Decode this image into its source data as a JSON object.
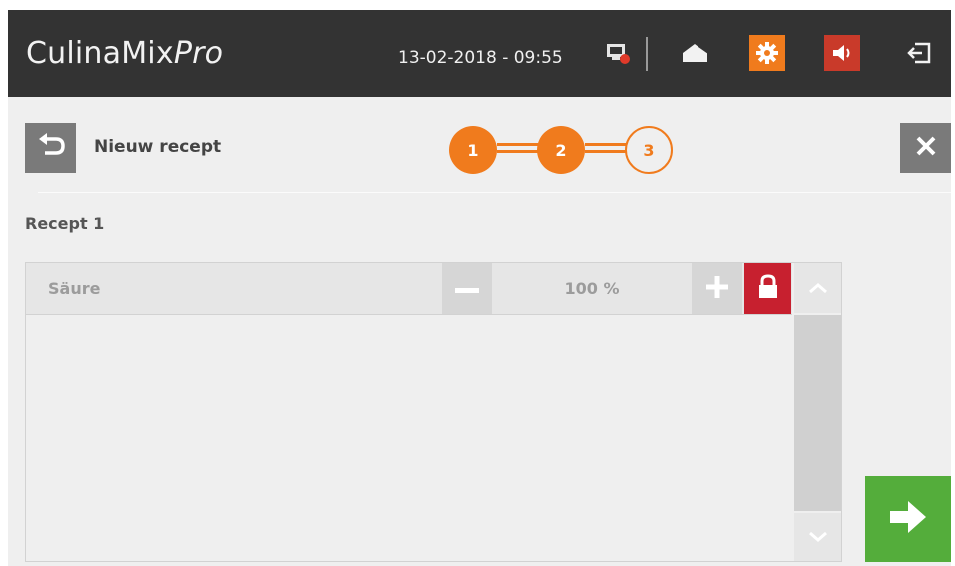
{
  "header": {
    "app_name": "CulinaMix",
    "app_name_suffix": "Pro",
    "datetime": "13-02-2018 - 09:55",
    "icons": [
      "display-status-icon",
      "home-icon",
      "gear-icon",
      "speaker-icon",
      "logout-icon"
    ]
  },
  "page": {
    "title": "Nieuw recept",
    "steps": [
      {
        "label": "1",
        "state": "completed"
      },
      {
        "label": "2",
        "state": "completed"
      },
      {
        "label": "3",
        "state": "pending"
      }
    ],
    "section_label": "Recept 1"
  },
  "ingredients": [
    {
      "name": "Säure",
      "percentage": "100 %",
      "locked": true
    }
  ],
  "colors": {
    "header_bg": "#333333",
    "accent_orange": "#f07b1d",
    "alert_red": "#c7202f",
    "confirm_green": "#54ad3b",
    "neutral_button": "#7a7a7a"
  }
}
